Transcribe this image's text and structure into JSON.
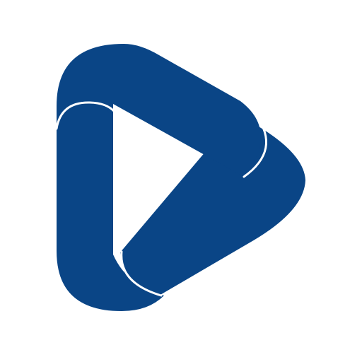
{
  "logo": {
    "icon": "play-button-icon",
    "colors": {
      "primary": "#0A4586",
      "background": "#FFFFFF",
      "separator": "#FFFFFF"
    }
  }
}
